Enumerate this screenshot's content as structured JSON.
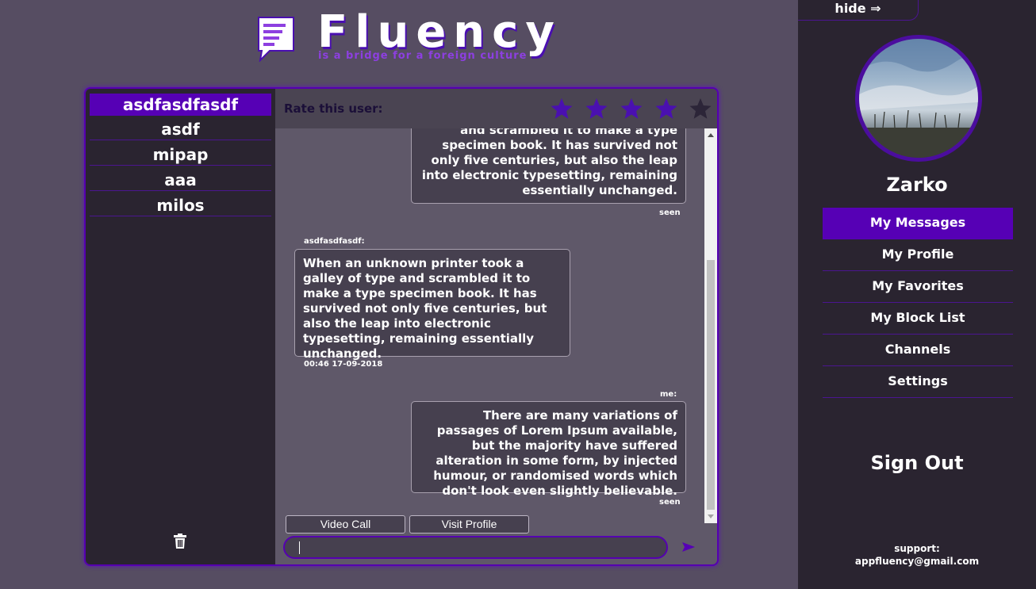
{
  "logo": {
    "title": "Fluency",
    "tagline": "is a bridge for a foreign culture"
  },
  "contacts": [
    {
      "name": "asdfasdfasdf",
      "active": true
    },
    {
      "name": "asdf",
      "active": false
    },
    {
      "name": "mipap",
      "active": false
    },
    {
      "name": "aaa",
      "active": false
    },
    {
      "name": "milos",
      "active": false
    }
  ],
  "rating": {
    "label": "Rate this user:",
    "max": 5,
    "value": 4
  },
  "messages": [
    {
      "from": "me",
      "text": "and scrambled it to make a type specimen book. It has survived not only five centuries, but also the leap into electronic typesetting, remaining essentially unchanged.",
      "status": "seen"
    },
    {
      "from": "them",
      "sender": "asdfasdfasdf:",
      "text": "When an unknown printer took a galley of type and scrambled it to make a type specimen book. It has survived not only five centuries, but also the leap into electronic typesetting, remaining essentially unchanged.",
      "time": "00:46 17-09-2018"
    },
    {
      "from": "me",
      "sender": "me:",
      "text": "There are many variations of passages of Lorem Ipsum available, but the majority have suffered alteration in some form, by injected humour, or randomised words which don't look even slightly believable.",
      "status": "seen"
    }
  ],
  "actions": {
    "video_call": "Video Call",
    "visit_profile": "Visit Profile"
  },
  "composer": {
    "value": ""
  },
  "sidebar": {
    "hide_label": "hide ⇒",
    "username": "Zarko",
    "nav": [
      {
        "label": "My Messages",
        "active": true
      },
      {
        "label": "My Profile",
        "active": false
      },
      {
        "label": "My Favorites",
        "active": false
      },
      {
        "label": "My Block List",
        "active": false
      },
      {
        "label": "Channels",
        "active": false
      },
      {
        "label": "Settings",
        "active": false
      }
    ],
    "sign_out": "Sign Out",
    "support_label": "support:",
    "support_email": "appfluency@gmail.com"
  },
  "colors": {
    "accent": "#5600b5",
    "background": "#564d62",
    "panel_dark": "#2a2430",
    "bubble": "#46404f",
    "star_active": "#4a10b0",
    "star_inactive": "#2c2538"
  }
}
